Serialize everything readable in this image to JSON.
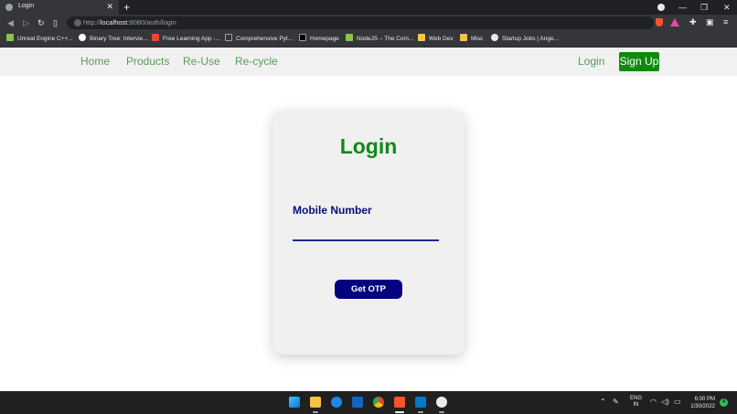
{
  "browser": {
    "tab_title": "Login",
    "tab_close": "✕",
    "new_tab": "+",
    "url_prefix": "http://",
    "url_host": "localhost",
    "url_rest": ":8080/auth/login",
    "bookmarks": [
      {
        "label": "Unreal Engine C++...",
        "icon_color": "#8bc34a"
      },
      {
        "label": "Binary Tree: Intervie...",
        "icon_color": "#ffffff"
      },
      {
        "label": "Free Learning App -...",
        "icon_color": "#f44336"
      },
      {
        "label": "Comprehensive Pyt...",
        "icon_color": "#35363a"
      },
      {
        "label": "Homepage",
        "icon_color": "#000000"
      },
      {
        "label": "NodeJS – The Com...",
        "icon_color": "#8bc34a"
      },
      {
        "label": "Web Dev",
        "icon_color": "#f4c542"
      },
      {
        "label": "Misc",
        "icon_color": "#f4c542"
      },
      {
        "label": "Startup Jobs | Ange...",
        "icon_color": "#e8eaed"
      }
    ]
  },
  "nav": {
    "links": [
      "Home",
      "Products",
      "Re-Use",
      "Re-cycle"
    ],
    "login": "Login",
    "signup": "Sign Up"
  },
  "login_card": {
    "title": "Login",
    "field_label": "Mobile Number",
    "mobile_value": "",
    "button": "Get OTP"
  },
  "taskbar": {
    "lang_top": "ENG",
    "lang_bottom": "IN",
    "time": "6:00 PM",
    "date": "1/30/2022",
    "notification_count": "4"
  },
  "colors": {
    "accent_green": "#0d8b0d",
    "title_green": "#0f8a17",
    "navy": "#030380"
  }
}
